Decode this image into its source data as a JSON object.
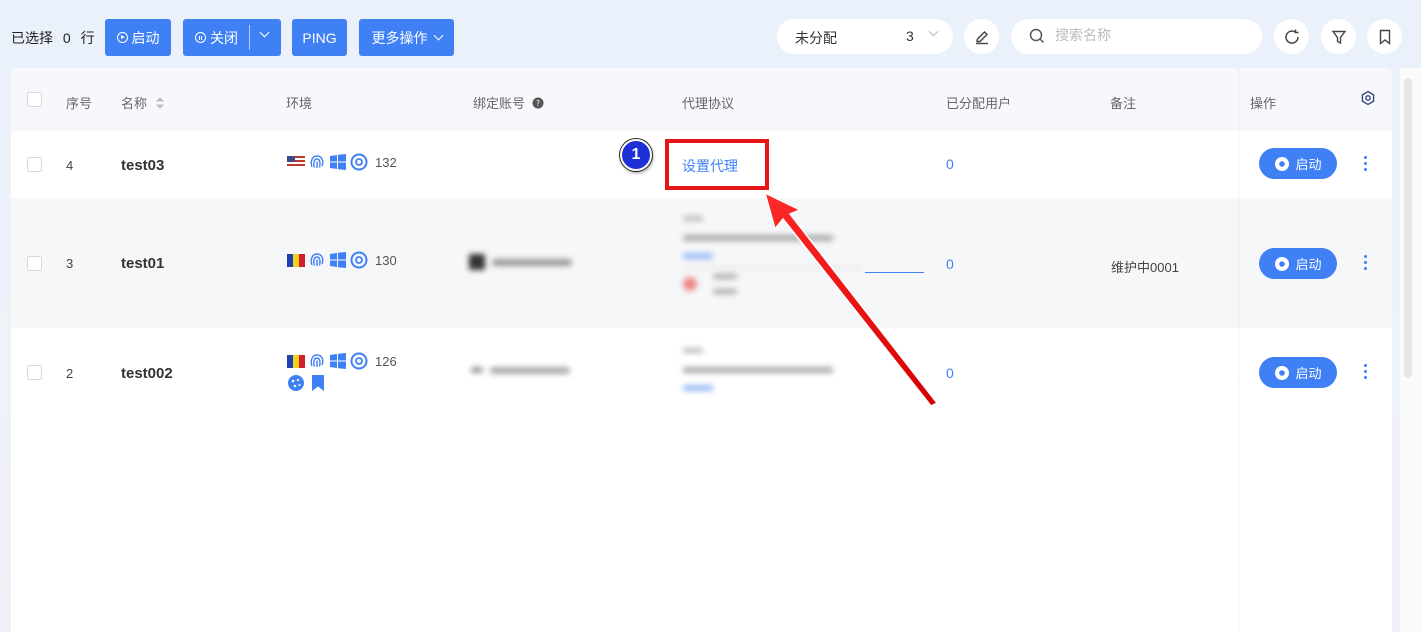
{
  "toolbar": {
    "selected_prefix": "已选择",
    "selected_count": "0",
    "selected_suffix": "行",
    "start_label": "启动",
    "close_label": "关闭",
    "ping_label": "PING",
    "more_label": "更多操作",
    "filter_value": "未分配",
    "filter_count": "3",
    "search_placeholder": "搜索名称"
  },
  "table": {
    "headers": {
      "index": "序号",
      "name": "名称",
      "env": "环境",
      "account": "绑定账号",
      "proxy": "代理协议",
      "users": "已分配用户",
      "note": "备注",
      "ops": "操作"
    },
    "rows": [
      {
        "index": "4",
        "name": "test03",
        "env_count": "132",
        "flag": "us",
        "proxy_link": "设置代理",
        "users": "0",
        "note": "",
        "start": "启动"
      },
      {
        "index": "3",
        "name": "test01",
        "env_count": "130",
        "flag": "ad",
        "proxy_link": "",
        "users": "0",
        "note": "维护中0001",
        "start": "启动"
      },
      {
        "index": "2",
        "name": "test002",
        "env_count": "126",
        "flag": "ad",
        "proxy_link": "",
        "users": "0",
        "note": "",
        "start": "启动"
      }
    ]
  },
  "annotation": {
    "step_number": "1"
  },
  "colors": {
    "primary": "#3f81f5",
    "highlight": "#e61616",
    "badge": "#1f2fd6"
  }
}
